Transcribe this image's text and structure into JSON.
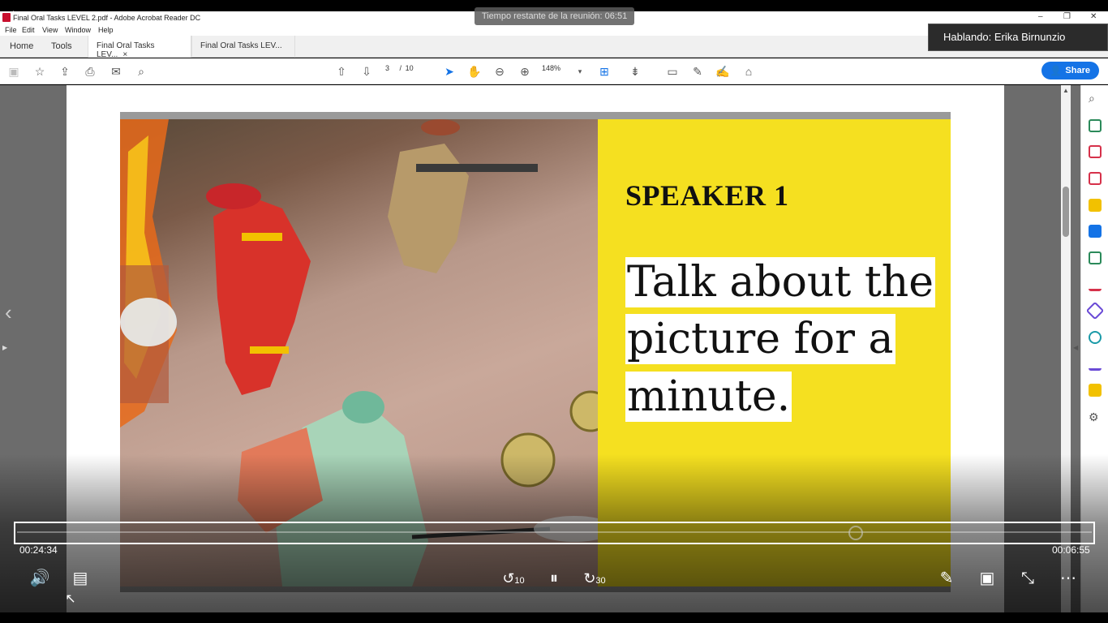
{
  "window": {
    "title": "Final Oral Tasks LEVEL 2.pdf - Adobe Acrobat Reader DC",
    "controls": {
      "minimize": "–",
      "restore": "❐",
      "close": "✕"
    }
  },
  "menu": [
    "File",
    "Edit",
    "View",
    "Window",
    "Help"
  ],
  "tabs": {
    "home": "Home",
    "tools": "Tools",
    "docs": [
      {
        "label": "Final Oral Tasks LEV...",
        "close": "×"
      },
      {
        "label": "Final Oral Tasks LEV..."
      }
    ]
  },
  "toolbar": {
    "page_current": "3",
    "page_sep": "/",
    "page_total": "10",
    "zoom": "148%",
    "share_label": "Share"
  },
  "meeting": {
    "timer": "Tiempo restante de la reunión: 06:51",
    "speaker": "Hablando: Erika Birnunzio"
  },
  "slide": {
    "heading": "SPEAKER 1",
    "lines": [
      "Talk about the",
      "picture for a",
      "minute."
    ]
  },
  "player": {
    "elapsed": "00:24:34",
    "remaining": "00:06:55",
    "progress_fraction": 0.78,
    "rewind_seconds": "10",
    "forward_seconds": "30"
  },
  "colors": {
    "slide_yellow": "#f5e020",
    "share_blue": "#1473e6"
  }
}
